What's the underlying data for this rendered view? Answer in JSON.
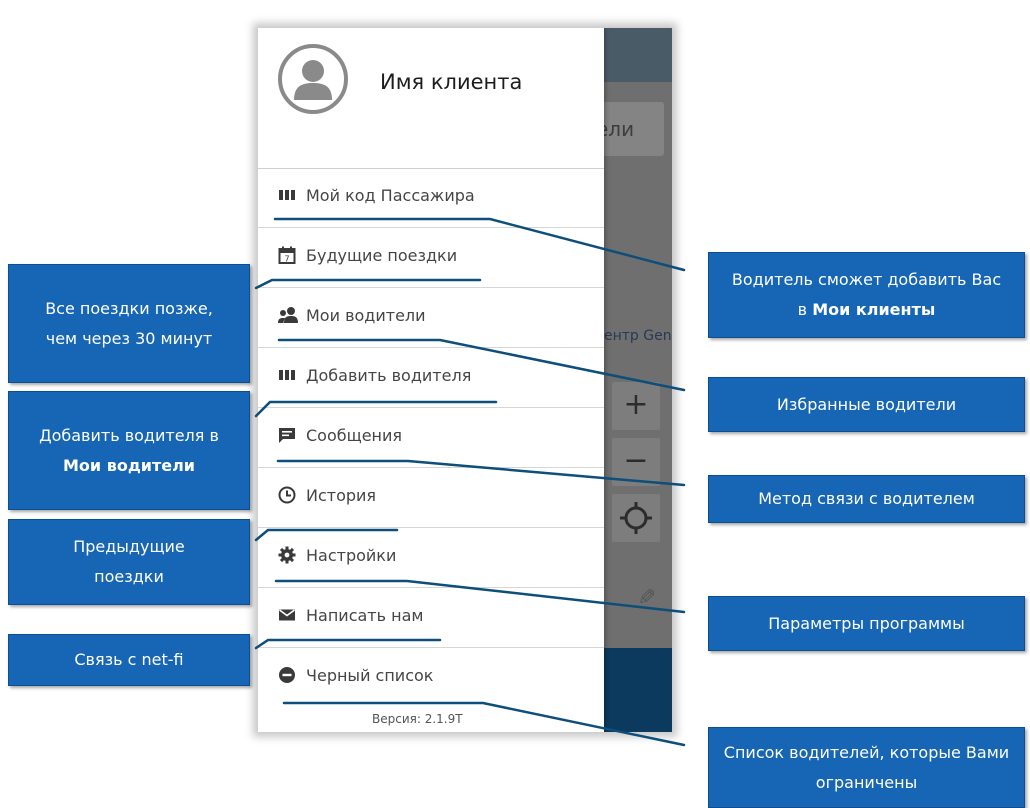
{
  "background_app": {
    "chip_text": "ели",
    "map_label": "ентр Gens",
    "zoom_in": "+",
    "zoom_out": "−"
  },
  "drawer": {
    "client_name": "Имя клиента",
    "menu": [
      {
        "label": "Мой код Пассажира",
        "icon": "barcode-icon"
      },
      {
        "label": "Будущие поездки",
        "icon": "calendar-icon"
      },
      {
        "label": "Мои водители",
        "icon": "people-icon"
      },
      {
        "label": "Добавить водителя",
        "icon": "barcode-icon"
      },
      {
        "label": "Сообщения",
        "icon": "message-icon"
      },
      {
        "label": "История",
        "icon": "clock-icon"
      },
      {
        "label": "Настройки",
        "icon": "gear-icon"
      },
      {
        "label": "Написать нам",
        "icon": "envelope-icon"
      },
      {
        "label": "Черный список",
        "icon": "minus-circle-icon"
      }
    ],
    "version": "Версия: 2.1.9T"
  },
  "callouts_left": [
    {
      "text": "Все поездки позже, чем через 30 минут"
    },
    {
      "text_prefix": "Добавить водителя в ",
      "text_bold": "Мои водители"
    },
    {
      "text": "Предыдущие поездки"
    },
    {
      "text": "Связь с net-fi"
    }
  ],
  "callouts_right": [
    {
      "text_prefix": "Водитель сможет добавить Вас в ",
      "text_bold": "Мои клиенты"
    },
    {
      "text": "Избранные водители"
    },
    {
      "text": "Метод связи с водителем"
    },
    {
      "text": "Параметры программы"
    },
    {
      "text": "Список водителей, которые Вами ограничены"
    }
  ],
  "colors": {
    "callout_bg": "#1766b5",
    "connector": "#0d4e7a",
    "drawer_bg": "#ffffff"
  }
}
